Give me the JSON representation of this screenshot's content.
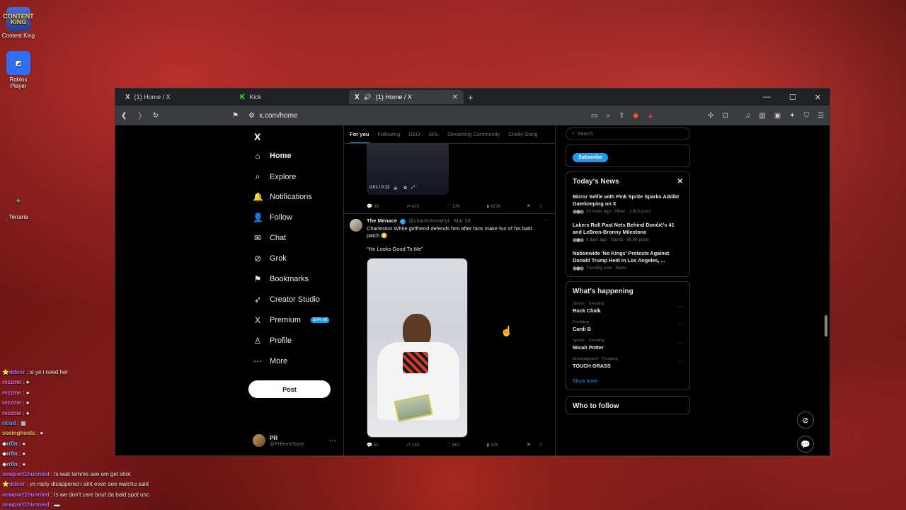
{
  "desktop": {
    "icons": [
      {
        "label": "Content King",
        "glyph": "CONTENT KING"
      },
      {
        "label": "Roblox Player",
        "glyph": "◩"
      },
      {
        "label": "Terraria",
        "glyph": "♣"
      }
    ]
  },
  "chat": [
    {
      "user": "ddosr",
      "msg": " : is ye i need her",
      "cls": "u-purple",
      "badge": "⭐"
    },
    {
      "user": "rezzme",
      "msg": " : ●",
      "cls": "u-pink",
      "badge": ""
    },
    {
      "user": "rezzme",
      "msg": " : ●",
      "cls": "u-pink",
      "badge": ""
    },
    {
      "user": "rezzme",
      "msg": " : ●",
      "cls": "u-pink",
      "badge": ""
    },
    {
      "user": "rezzme",
      "msg": " : ●",
      "cls": "u-pink",
      "badge": ""
    },
    {
      "user": "ricod",
      "msg": " : ▦",
      "cls": "u-blue",
      "badge": ""
    },
    {
      "user": "seeinghosts",
      "msg": " : ●",
      "cls": "u-yellow",
      "badge": ""
    },
    {
      "user": "rr0n",
      "msg": " : ●",
      "cls": "u-lblue",
      "badge": "◆"
    },
    {
      "user": "rr0n",
      "msg": " : ●",
      "cls": "u-lblue",
      "badge": "◆"
    },
    {
      "user": "rr0n",
      "msg": " : ●",
      "cls": "u-lblue",
      "badge": "◆"
    },
    {
      "user": "newport1hunnied",
      "msg": " : Is wait lemme see em get shot",
      "cls": "u-purple",
      "badge": ""
    },
    {
      "user": "ddosr",
      "msg": " : yo reply disappered i aint even see watchu said",
      "cls": "u-purple",
      "badge": "⭐"
    },
    {
      "user": "newport1hunnied",
      "msg": " : Is we don't care bout da bald spot unc",
      "cls": "u-purple",
      "badge": ""
    },
    {
      "user": "newport1hunnied",
      "msg": " : ▬",
      "cls": "u-purple",
      "badge": ""
    }
  ],
  "browser": {
    "tabs": [
      {
        "title": "(1) Home / X",
        "logo": "X",
        "active": false
      },
      {
        "title": "Kick",
        "logo": "K",
        "active": false
      },
      {
        "title": "(1) Home / X",
        "logo": "X",
        "active": true
      }
    ],
    "new_tab": "+",
    "url": "x.com/home",
    "win_min": "—",
    "win_max": "☐",
    "win_close": "✕"
  },
  "nav": {
    "logo": "X",
    "items": [
      {
        "label": "Home",
        "icon": "⌂"
      },
      {
        "label": "Explore",
        "icon": "⌕"
      },
      {
        "label": "Notifications",
        "icon": "🔔"
      },
      {
        "label": "Follow",
        "icon": "👤"
      },
      {
        "label": "Chat",
        "icon": "✉"
      },
      {
        "label": "Grok",
        "icon": "⊘"
      },
      {
        "label": "Bookmarks",
        "icon": "⚑"
      },
      {
        "label": "Creator Studio",
        "icon": "➶"
      },
      {
        "label": "Premium",
        "icon": "X"
      },
      {
        "label": "Profile",
        "icon": "♙"
      },
      {
        "label": "More",
        "icon": "⋯"
      }
    ],
    "premium_badge": "50% off",
    "post_label": "Post",
    "account": {
      "name": "PR",
      "handle": "@PrBeenStone",
      "more": "···"
    }
  },
  "timeline": {
    "tabs": [
      "For you",
      "Following",
      "DEO",
      "ARL",
      "Streaming Community",
      "Chelly Gang"
    ],
    "embed_time": "0:01 / 0:12",
    "prev_actions": {
      "replies": "38",
      "reposts": "423",
      "likes": "17K",
      "views": "422K"
    },
    "tweet": {
      "name": "The Menace",
      "handle": "@charlestonwhyt · Mar 28",
      "text": "Charleston White girlfriend defends him after fans make fun of his bald patch 😳",
      "quote": "\"He Looks Good To Me\"",
      "actions": {
        "replies": "50",
        "reposts": "148",
        "likes": "867",
        "views": "92K"
      }
    }
  },
  "right": {
    "search_placeholder": "Search",
    "subscribe": "Subscribe",
    "news_title": "Today's News",
    "news": [
      {
        "headline": "Mirror Selfie with Pink Sprite Sparks Addikt Gatekeeping on X",
        "meta": "19 hours ago · Other · 1,613 posts"
      },
      {
        "headline": "Lakers Roll Past Nets Behind Dončić's 41 and LeBron-Bronny Milestone",
        "meta": "3 days ago · Sports · 96.6K posts"
      },
      {
        "headline": "Nationwide 'No Kings' Protests Against Donald Trump Held in Los Angeles, ...",
        "meta": "Trending now · News"
      }
    ],
    "happening_title": "What's happening",
    "trends": [
      {
        "meta": "Sports · Trending",
        "name": "Rock Chalk"
      },
      {
        "meta": "Trending",
        "name": "Cardi B"
      },
      {
        "meta": "Sports · Trending",
        "name": "Micah Potter"
      },
      {
        "meta": "Entertainment · Trending",
        "name": "TOUCH GRASS"
      }
    ],
    "show_more": "Show more",
    "who_to_follow": "Who to follow"
  }
}
